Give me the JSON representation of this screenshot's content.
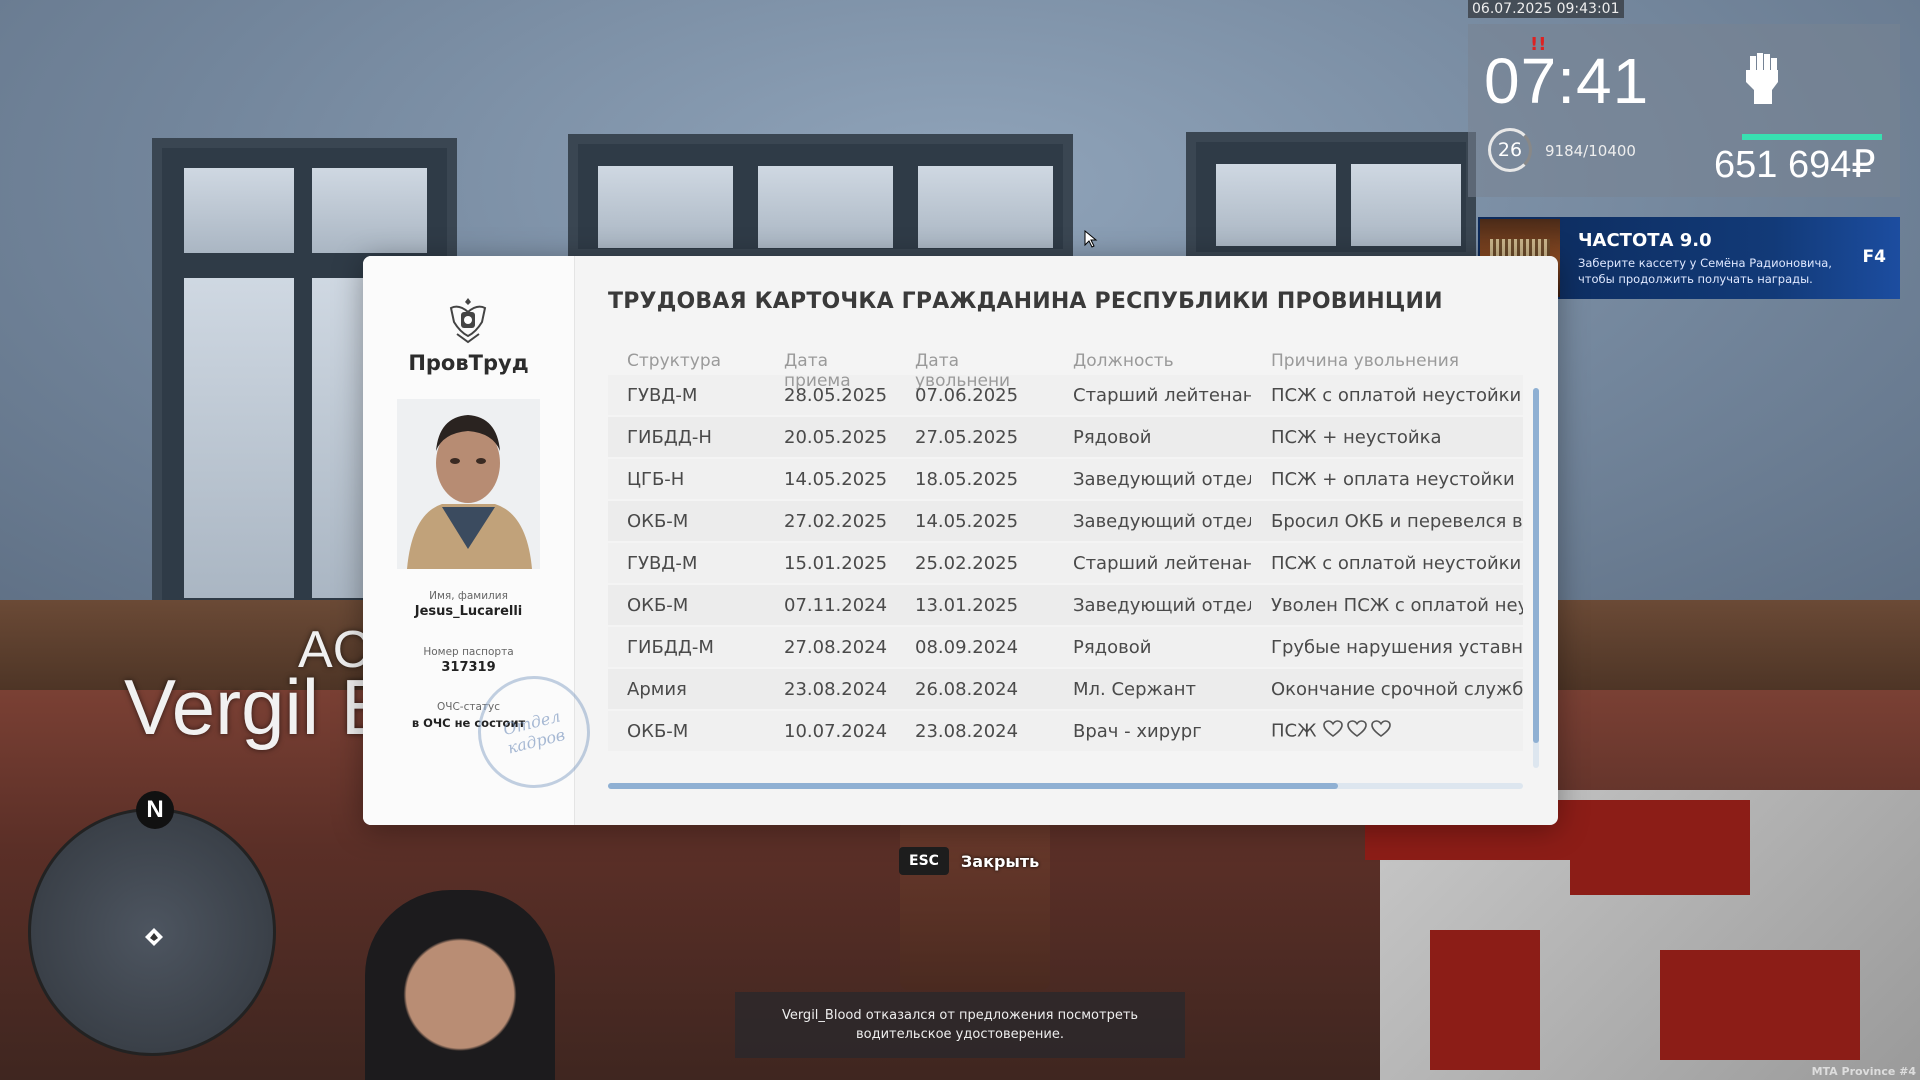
{
  "hud": {
    "datetime": "06.07.2025 09:43:01",
    "clock": "07:41",
    "level": "26",
    "xp": "9184/10400",
    "money": "651 694₽",
    "health_fraction": 1.0
  },
  "radio": {
    "title": "ЧАСТОТА 9.0",
    "subtitle": "Заберите кассету у Семёна Радионовича, чтобы продолжить получать награды.",
    "key": "F4"
  },
  "world": {
    "abbr": "AC",
    "name": "Vergil B"
  },
  "minimap": {
    "north_label": "N"
  },
  "card": {
    "brand": "ПровТруд",
    "title": "ТРУДОВАЯ КАРТОЧКА ГРАЖДАНИНА РЕСПУБЛИКИ ПРОВИНЦИИ",
    "name_label": "Имя, фамилия",
    "name_value": "Jesus_Lucarelli",
    "passport_label": "Номер паспорта",
    "passport_value": "317319",
    "status_label": "ОЧС-статус",
    "status_value": "в ОЧС не состоит",
    "stamp_text": "Отдел кадров",
    "columns": [
      "Структура",
      "Дата приема",
      "Дата увольнени",
      "Должность",
      "Причина увольнения"
    ],
    "rows": [
      [
        "ГУВД-М",
        "28.05.2025",
        "07.06.2025",
        "Старший лейтенант",
        "ПСЖ с оплатой неустойки"
      ],
      [
        "ГИБДД-Н",
        "20.05.2025",
        "27.05.2025",
        "Рядовой",
        "ПСЖ + неустойка"
      ],
      [
        "ЦГБ-Н",
        "14.05.2025",
        "18.05.2025",
        "Заведующий отделе",
        "ПСЖ + оплата неустойки"
      ],
      [
        "ОКБ-М",
        "27.02.2025",
        "14.05.2025",
        "Заведующий отделе",
        "Бросил ОКБ и перевелся в Ц"
      ],
      [
        "ГУВД-М",
        "15.01.2025",
        "25.02.2025",
        "Старший лейтенант",
        "ПСЖ с оплатой неустойки"
      ],
      [
        "ОКБ-М",
        "07.11.2024",
        "13.01.2025",
        "Заведующий отделе",
        "Уволен ПСЖ с оплатой неуст"
      ],
      [
        "ГИБДД-М",
        "27.08.2024",
        "08.09.2024",
        "Рядовой",
        "Грубые нарушения уставных ,"
      ],
      [
        "Армия",
        "23.08.2024",
        "26.08.2024",
        "Мл. Сержант",
        "Окончание срочной службы."
      ],
      [
        "ОКБ-М",
        "10.07.2024",
        "23.08.2024",
        "Врач - хирург",
        "ПСЖ"
      ]
    ],
    "last_row_hearts": 3
  },
  "close": {
    "key": "ESC",
    "label": "Закрыть"
  },
  "notice": "Vergil_Blood отказался от предложения посмотреть водительское удостоверение.",
  "watermark": "MTA Province #4",
  "colors": {
    "accent": "#8fb0d3",
    "health": "#38e0b1",
    "radio_bg": "#123a78"
  }
}
